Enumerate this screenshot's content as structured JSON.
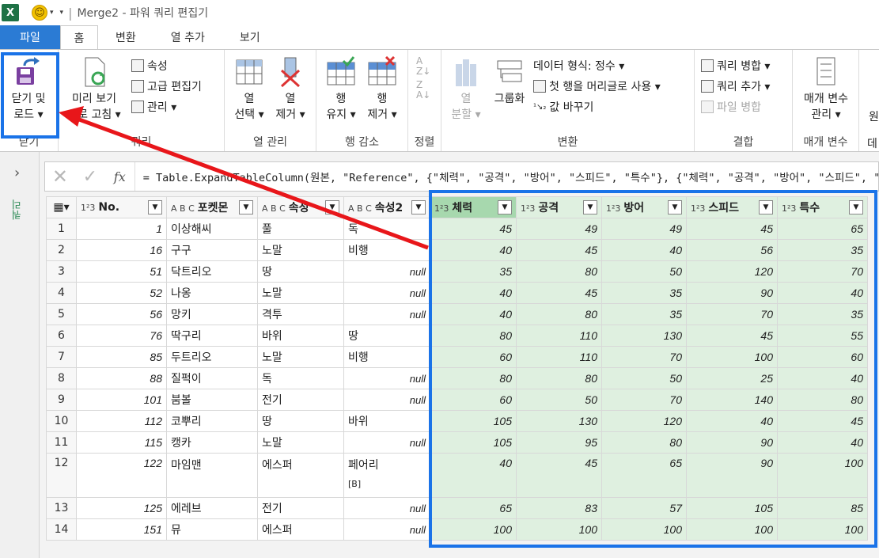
{
  "titlebar": {
    "app_icon": "X",
    "title": "Merge2 - 파워 쿼리 편집기",
    "separator": "|"
  },
  "tabs": [
    "파일",
    "홈",
    "변환",
    "열 추가",
    "보기"
  ],
  "ribbon": {
    "close_load": {
      "line1": "닫기 및",
      "line2": "로드 ▾",
      "group": "닫기"
    },
    "preview": {
      "line1": "미리 보기",
      "line2": "새로 고침 ▾",
      "group": "쿼리"
    },
    "props": "속성",
    "adv_editor": "고급 편집기",
    "manage": "관리 ▾",
    "col_select": {
      "line1": "열",
      "line2": "선택 ▾"
    },
    "col_remove": {
      "line1": "열",
      "line2": "제거 ▾"
    },
    "col_group": "열 관리",
    "row_keep": {
      "line1": "행",
      "line2": "유지 ▾"
    },
    "row_remove": {
      "line1": "행",
      "line2": "제거 ▾"
    },
    "row_group": "행 감소",
    "sort_group": "정렬",
    "split": {
      "line1": "열",
      "line2": "분할 ▾"
    },
    "groupby": "그룹화",
    "datatype": "데이터 형식: 정수 ▾",
    "first_row": "첫 행을 머리글로 사용 ▾",
    "replace": "값 바꾸기",
    "transform_group": "변환",
    "merge_q": "쿼리 병합 ▾",
    "append_q": "쿼리 추가 ▾",
    "merge_f": "파일 병합",
    "combine_group": "결합",
    "params": {
      "line1": "매개 변수",
      "line2": "관리 ▾",
      "group": "매개 변수"
    },
    "cut1": "원",
    "cut2": "데"
  },
  "leftpanel": {
    "label": "쿼리"
  },
  "formula": "= Table.ExpandTableColumn(원본, \"Reference\", {\"체력\", \"공격\", \"방어\", \"스피드\", \"특수\"}, {\"체력\", \"공격\", \"방어\", \"스피드\", \"특수\"})",
  "columns": [
    {
      "type": "1²3",
      "name": "No."
    },
    {
      "type": "A B C",
      "name": "포켓몬"
    },
    {
      "type": "A B C",
      "name": "속성"
    },
    {
      "type": "A B C",
      "name": "속성2"
    },
    {
      "type": "1²3",
      "name": "체력"
    },
    {
      "type": "1²3",
      "name": "공격"
    },
    {
      "type": "1²3",
      "name": "방어"
    },
    {
      "type": "1²3",
      "name": "스피드"
    },
    {
      "type": "1²3",
      "name": "특수"
    }
  ],
  "rows": [
    {
      "n": "1",
      "no": "1",
      "name": "이상해씨",
      "t1": "풀",
      "t2": "독",
      "hp": "45",
      "atk": "49",
      "def": "49",
      "spd": "45",
      "sp": "65"
    },
    {
      "n": "2",
      "no": "16",
      "name": "구구",
      "t1": "노말",
      "t2": "비행",
      "hp": "40",
      "atk": "45",
      "def": "40",
      "spd": "56",
      "sp": "35"
    },
    {
      "n": "3",
      "no": "51",
      "name": "닥트리오",
      "t1": "땅",
      "t2": "null",
      "hp": "35",
      "atk": "80",
      "def": "50",
      "spd": "120",
      "sp": "70"
    },
    {
      "n": "4",
      "no": "52",
      "name": "나옹",
      "t1": "노말",
      "t2": "null",
      "hp": "40",
      "atk": "45",
      "def": "35",
      "spd": "90",
      "sp": "40"
    },
    {
      "n": "5",
      "no": "56",
      "name": "망키",
      "t1": "격투",
      "t2": "null",
      "hp": "40",
      "atk": "80",
      "def": "35",
      "spd": "70",
      "sp": "35"
    },
    {
      "n": "6",
      "no": "76",
      "name": "딱구리",
      "t1": "바위",
      "t2": "땅",
      "hp": "80",
      "atk": "110",
      "def": "130",
      "spd": "45",
      "sp": "55"
    },
    {
      "n": "7",
      "no": "85",
      "name": "두트리오",
      "t1": "노말",
      "t2": "비행",
      "hp": "60",
      "atk": "110",
      "def": "70",
      "spd": "100",
      "sp": "60"
    },
    {
      "n": "8",
      "no": "88",
      "name": "질퍽이",
      "t1": "독",
      "t2": "null",
      "hp": "80",
      "atk": "80",
      "def": "50",
      "spd": "25",
      "sp": "40"
    },
    {
      "n": "9",
      "no": "101",
      "name": "붐볼",
      "t1": "전기",
      "t2": "null",
      "hp": "60",
      "atk": "50",
      "def": "70",
      "spd": "140",
      "sp": "80"
    },
    {
      "n": "10",
      "no": "112",
      "name": "코뿌리",
      "t1": "땅",
      "t2": "바위",
      "hp": "105",
      "atk": "130",
      "def": "120",
      "spd": "40",
      "sp": "45"
    },
    {
      "n": "11",
      "no": "115",
      "name": "캥카",
      "t1": "노말",
      "t2": "null",
      "hp": "105",
      "atk": "95",
      "def": "80",
      "spd": "90",
      "sp": "40"
    },
    {
      "n": "12",
      "no": "122",
      "name": "마임맨",
      "t1": "에스퍼",
      "t2": "페어리",
      "t2b": "[B]",
      "hp": "40",
      "atk": "45",
      "def": "65",
      "spd": "90",
      "sp": "100"
    },
    {
      "n": "13",
      "no": "125",
      "name": "에레브",
      "t1": "전기",
      "t2": "null",
      "hp": "65",
      "atk": "83",
      "def": "57",
      "spd": "105",
      "sp": "85"
    },
    {
      "n": "14",
      "no": "151",
      "name": "뮤",
      "t1": "에스퍼",
      "t2": "null",
      "hp": "100",
      "atk": "100",
      "def": "100",
      "spd": "100",
      "sp": "100"
    }
  ]
}
